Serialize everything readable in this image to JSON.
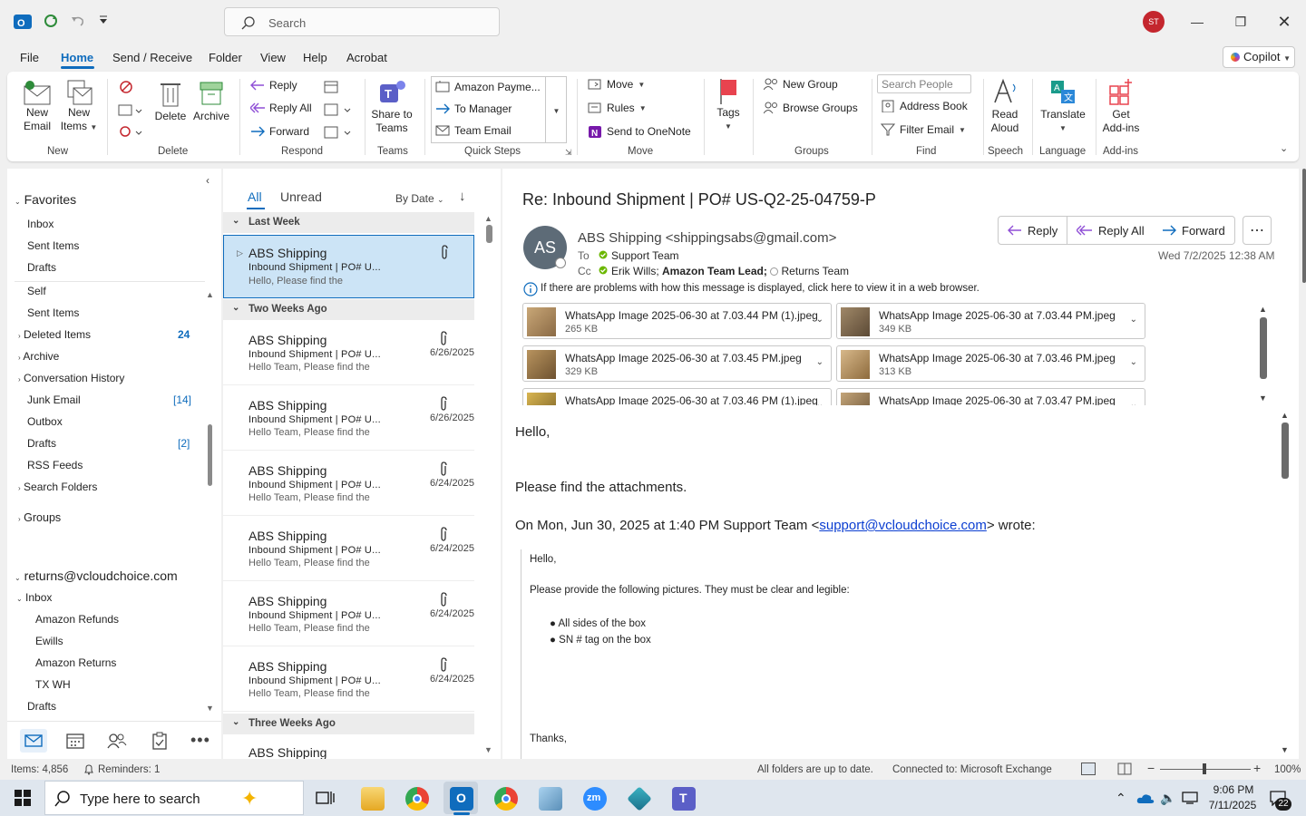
{
  "titlebar": {
    "search_placeholder": "Search",
    "user_initials": "ST"
  },
  "menu": {
    "tabs": [
      "File",
      "Home",
      "Send / Receive",
      "Folder",
      "View",
      "Help",
      "Acrobat"
    ],
    "copilot_label": "Copilot"
  },
  "ribbon": {
    "new": {
      "new_email": [
        "New",
        "Email"
      ],
      "new_items": [
        "New",
        "Items"
      ],
      "label": "New"
    },
    "delete": {
      "delete": "Delete",
      "archive": "Archive",
      "label": "Delete"
    },
    "respond": {
      "reply": "Reply",
      "reply_all": "Reply All",
      "forward": "Forward",
      "label": "Respond"
    },
    "teams": {
      "share": [
        "Share to",
        "Teams"
      ],
      "label": "Teams"
    },
    "quick_steps": {
      "items": [
        "Amazon Payme...",
        "To Manager",
        "Team Email"
      ],
      "label": "Quick Steps"
    },
    "move": {
      "move": "Move",
      "rules": "Rules",
      "onenote": "Send to OneNote",
      "label": "Move"
    },
    "tags": {
      "tags": "Tags"
    },
    "groups": {
      "new_group": "New Group",
      "browse_groups": "Browse Groups",
      "label": "Groups"
    },
    "find": {
      "search_people_placeholder": "Search People",
      "address_book": "Address Book",
      "filter_email": "Filter Email",
      "label": "Find"
    },
    "speech": {
      "read_aloud": [
        "Read",
        "Aloud"
      ],
      "label": "Speech"
    },
    "language": {
      "translate": "Translate",
      "label": "Language"
    },
    "addins": {
      "get_addins": [
        "Get",
        "Add-ins"
      ],
      "label": "Add-ins"
    }
  },
  "folders": {
    "favorites_header": "Favorites",
    "favorites": [
      "Inbox",
      "Sent Items",
      "Drafts",
      "Self",
      "Sent Items"
    ],
    "deleted_items": "Deleted Items",
    "deleted_count": "24",
    "archive": "Archive",
    "conversation_history": "Conversation History",
    "junk": "Junk Email",
    "junk_count": "[14]",
    "outbox": "Outbox",
    "drafts": "Drafts",
    "drafts_count": "[2]",
    "rss": "RSS Feeds",
    "search_folders": "Search Folders",
    "groups": "Groups",
    "account": "returns@vcloudchoice.com",
    "inbox": "Inbox",
    "inbox_sub": [
      "Amazon Refunds",
      "Ewills",
      "Amazon Returns",
      "TX WH"
    ],
    "drafts2": "Drafts"
  },
  "list": {
    "tab_all": "All",
    "tab_unread": "Unread",
    "sort": "By Date",
    "groups": [
      "Last Week",
      "Two Weeks Ago",
      "Three Weeks Ago"
    ],
    "messages": [
      {
        "from": "ABS Shipping",
        "subject": "Inbound Shipment | PO# U...",
        "preview": "Hello,  Please find the",
        "date": ""
      },
      {
        "from": "ABS Shipping",
        "subject": "Inbound Shipment | PO# U...",
        "preview": "Hello Team,  Please find the",
        "date": "6/26/2025"
      },
      {
        "from": "ABS Shipping",
        "subject": "Inbound Shipment | PO# U...",
        "preview": "Hello Team,  Please find the",
        "date": "6/26/2025"
      },
      {
        "from": "ABS Shipping",
        "subject": "Inbound Shipment | PO# U...",
        "preview": "Hello Team,  Please find the",
        "date": "6/24/2025"
      },
      {
        "from": "ABS Shipping",
        "subject": "Inbound Shipment | PO# U...",
        "preview": "Hello Team,  Please find the",
        "date": "6/24/2025"
      },
      {
        "from": "ABS Shipping",
        "subject": "Inbound Shipment | PO# U...",
        "preview": "Hello Team,  Please find the",
        "date": "6/24/2025"
      },
      {
        "from": "ABS Shipping",
        "subject": "Inbound Shipment | PO# U...",
        "preview": "Hello Team,  Please find the",
        "date": "6/24/2025"
      },
      {
        "from": "ABS Shipping",
        "subject": "",
        "preview": "",
        "date": ""
      }
    ]
  },
  "email": {
    "subject": "Re: Inbound Shipment | PO# US-Q2-25-04759-P",
    "avatar_initials": "AS",
    "sender": "ABS Shipping <shippingsabs@gmail.com>",
    "to_label": "To",
    "to": "Support Team",
    "cc_label": "Cc",
    "cc_1": "Erik Wills;",
    "cc_2": "Amazon Team Lead;",
    "cc_3": "Returns Team",
    "date": "Wed 7/2/2025 12:38 AM",
    "reply": "Reply",
    "reply_all": "Reply All",
    "forward": "Forward",
    "info_bar": "If there are problems with how this message is displayed, click here to view it in a web browser.",
    "attachments": [
      {
        "name": "WhatsApp Image 2025-06-30 at 7.03.44 PM (1).jpeg",
        "size": "265 KB"
      },
      {
        "name": "WhatsApp Image 2025-06-30 at 7.03.44 PM.jpeg",
        "size": "349 KB"
      },
      {
        "name": "WhatsApp Image 2025-06-30 at 7.03.45 PM.jpeg",
        "size": "329 KB"
      },
      {
        "name": "WhatsApp Image 2025-06-30 at 7.03.46 PM.jpeg",
        "size": "313 KB"
      },
      {
        "name": "WhatsApp Image 2025-06-30 at 7.03.46 PM (1).jpeg",
        "size": ""
      },
      {
        "name": "WhatsApp Image 2025-06-30 at 7.03.47 PM.jpeg",
        "size": ""
      }
    ],
    "body_hello": "Hello,",
    "body_line": "Please find the attachments.",
    "quote_header_pre": "On Mon, Jun 30, 2025 at 1:40 PM Support Team <",
    "quote_header_link": "support@vcloudchoice.com",
    "quote_header_post": "> wrote:",
    "quote_hello": "Hello,",
    "quote_request": "Please provide the following pictures.  They must be clear and legible:",
    "quote_bullets": [
      "All sides of the box",
      "SN # tag on the box"
    ],
    "quote_thanks": "Thanks,"
  },
  "status": {
    "items": "Items: 4,856",
    "reminders": "Reminders: 1",
    "sync": "All folders are up to date.",
    "connection": "Connected to: Microsoft Exchange",
    "zoom": "100%"
  },
  "taskbar": {
    "search_placeholder": "Type here to search",
    "time": "9:06 PM",
    "date": "7/11/2025",
    "notif_count": "22"
  },
  "colors": {
    "accent": "#0f6cbd",
    "selected": "#cce4f6",
    "avatar_red": "#c4262e"
  }
}
